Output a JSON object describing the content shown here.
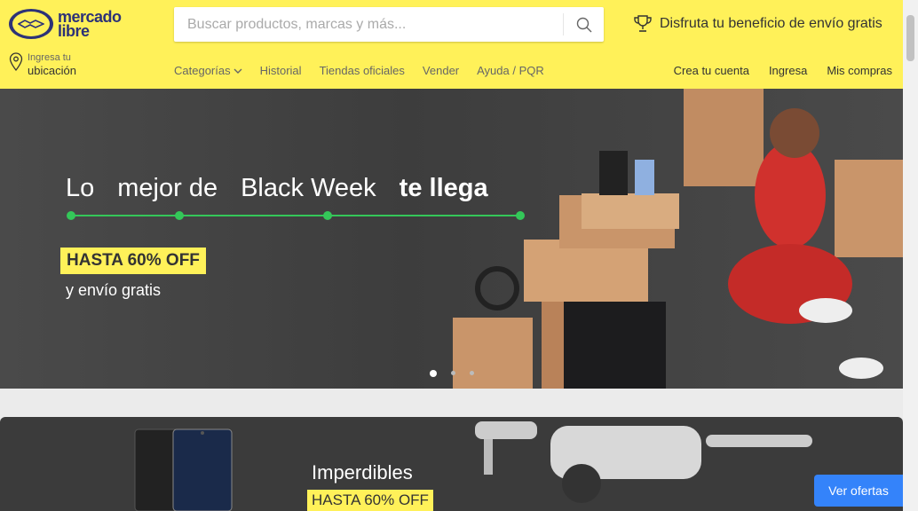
{
  "header": {
    "logo_line1": "mercado",
    "logo_line2": "libre",
    "search_placeholder": "Buscar productos, marcas y más...",
    "promo_text": "Disfruta tu beneficio de envío gratis",
    "location_small": "Ingresa tu",
    "location_big": "ubicación",
    "nav": [
      "Categorías",
      "Historial",
      "Tiendas oficiales",
      "Vender",
      "Ayuda / PQR"
    ],
    "account": [
      "Crea tu cuenta",
      "Ingresa",
      "Mis compras"
    ]
  },
  "hero": {
    "title_words": [
      "Lo",
      "mejor de",
      "Black Week",
      "te llega"
    ],
    "badge": "HASTA 60% OFF",
    "subtitle": "y envío gratis",
    "slides_total": 3,
    "slide_active": 1
  },
  "banner2": {
    "title": "Imperdibles",
    "badge": "HASTA 60% OFF",
    "button": "Ver ofertas"
  },
  "colors": {
    "header_bg": "#fff159",
    "brand_blue": "#2d3277",
    "accent_green": "#34c759",
    "button_blue": "#3483fa"
  },
  "icons": [
    "handshake-logo-icon",
    "search-icon",
    "trophy-icon",
    "location-pin-icon",
    "chevron-down-icon"
  ]
}
